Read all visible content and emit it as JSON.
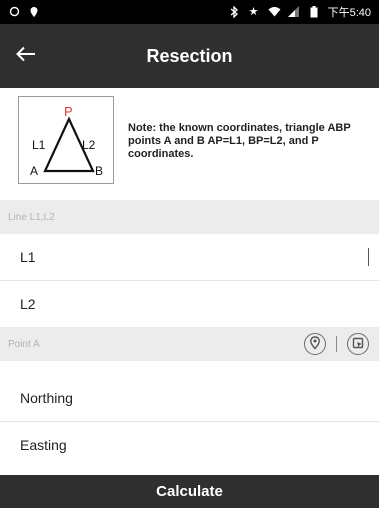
{
  "status_bar": {
    "time": "下午5:40",
    "icons": [
      "sync-icon",
      "location-pin-icon",
      "bluetooth-icon",
      "star-icon",
      "wifi-icon",
      "signal-icon",
      "battery-icon"
    ]
  },
  "app_bar": {
    "title": "Resection",
    "back_icon": "arrow-left-icon"
  },
  "diagram": {
    "apex": "P",
    "left_side": "L1",
    "right_side": "L2",
    "base_left": "A",
    "base_right": "B",
    "apex_color": "#e53935"
  },
  "note": "Note: the known coordinates, triangle ABP points A and B AP=L1, BP=L2, and P coordinates.",
  "section_line": {
    "header": "Line L1,L2",
    "fields": [
      {
        "label": "L1",
        "value": ""
      },
      {
        "label": "L2",
        "value": ""
      }
    ]
  },
  "section_point": {
    "header": "Point A",
    "fields": [
      {
        "label": "Northing",
        "value": ""
      },
      {
        "label": "Easting",
        "value": ""
      }
    ]
  },
  "calculate_label": "Calculate"
}
